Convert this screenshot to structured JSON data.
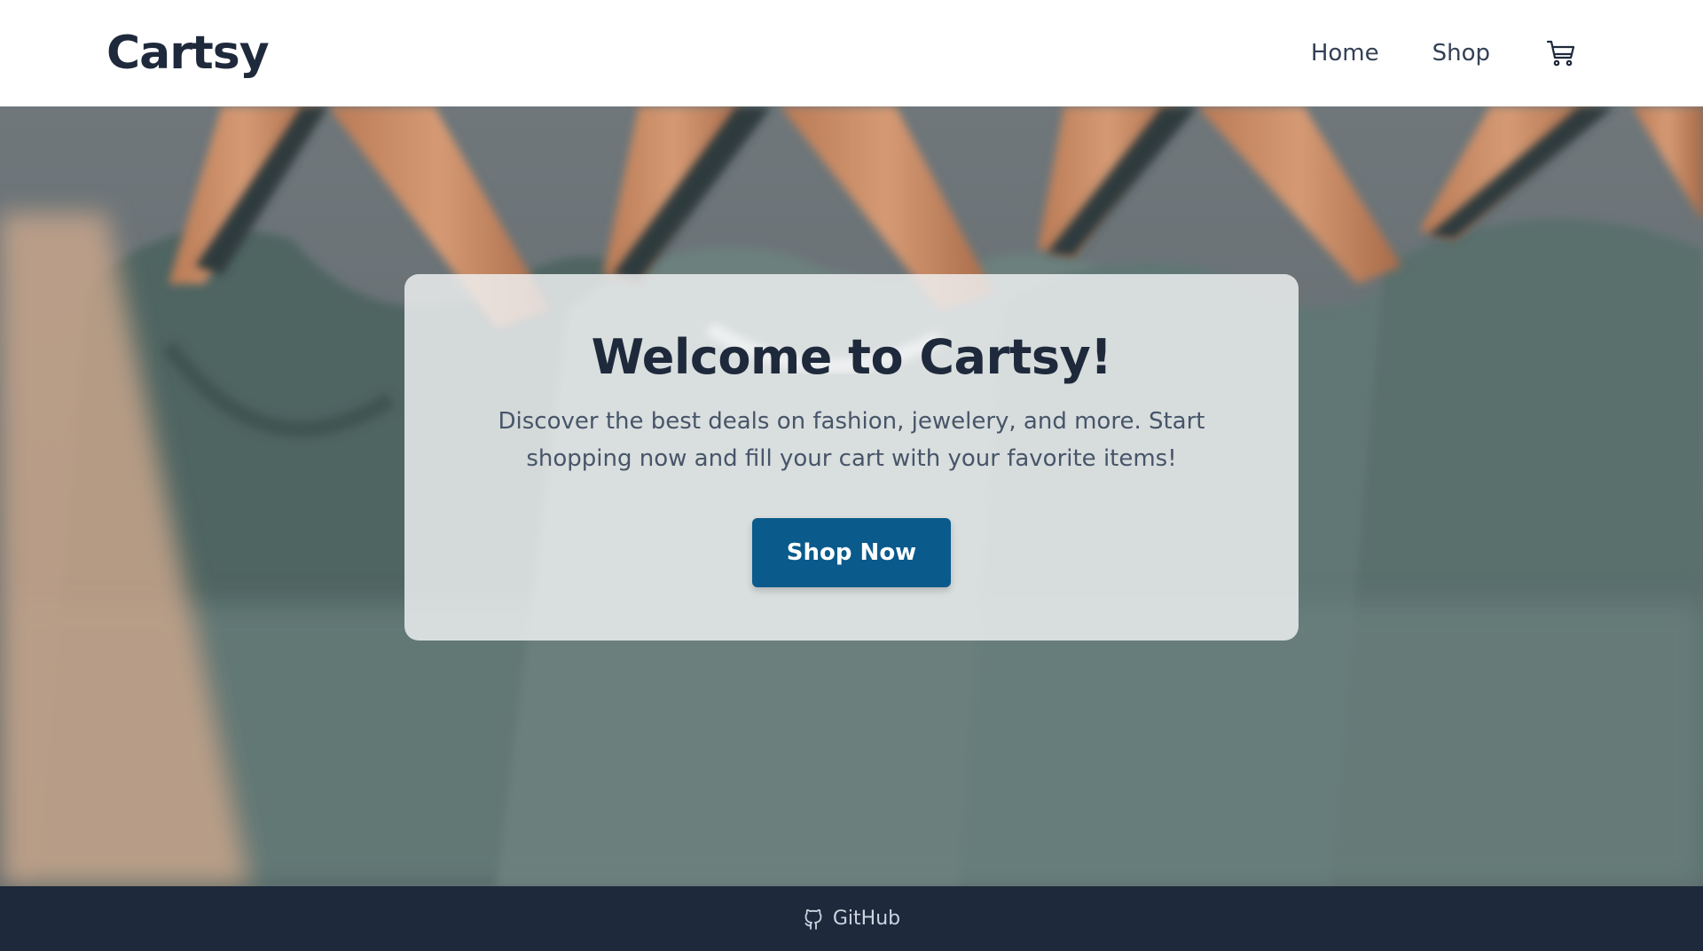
{
  "header": {
    "brand": "Cartsy",
    "nav": [
      {
        "label": "Home"
      },
      {
        "label": "Shop"
      }
    ],
    "cart_icon": "cart-icon"
  },
  "hero": {
    "title": "Welcome to Cartsy!",
    "description": "Discover the best deals on fashion, jewelery, and more. Start shopping now and fill your cart with your favorite items!",
    "cta_label": "Shop Now"
  },
  "footer": {
    "github_label": "GitHub",
    "github_icon": "github-icon"
  },
  "colors": {
    "brand_text": "#1e293b",
    "primary_button": "#0a5a8c",
    "footer_bg": "#1e293b"
  }
}
